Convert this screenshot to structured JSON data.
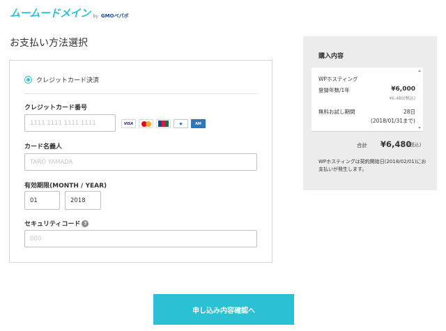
{
  "header": {
    "logo_text": "ムームードメイン",
    "logo_by": "by",
    "logo_company": "GMOペパボ"
  },
  "page": {
    "title": "お支払い方法選択"
  },
  "payment": {
    "method_label": "クレジットカード決済",
    "card_number": {
      "label": "クレジットカード番号",
      "placeholder": "1111 1111 1111 1111"
    },
    "card_brands": [
      "VISA",
      "MasterCard",
      "JCB",
      "Diners Club",
      "American Express"
    ],
    "card_holder": {
      "label": "カード名義人",
      "placeholder": "TARO YAMADA"
    },
    "expiry": {
      "label": "有効期限(MONTH / YEAR)",
      "month": "01",
      "year": "2018"
    },
    "security_code": {
      "label": "セキュリティコード",
      "placeholder": "000",
      "help_symbol": "?"
    }
  },
  "summary": {
    "title": "購入内容",
    "plan": "WPホスティング",
    "term_label": "登録年数/1年",
    "term_price": "¥6,000",
    "term_price_tax": "¥6,480(税込)",
    "trial_label": "無料お試し期間",
    "trial_days": "28日",
    "trial_until": "(2018/01/31まで)",
    "total_label": "合計",
    "total_amount": "¥6,480",
    "total_tax": "(税込)",
    "note": "WPホスティングは契約開始日(2018/02/01)にお支払いが発生します。"
  },
  "submit_label": "申し込み内容確認へ",
  "colors": {
    "accent": "#29c1d3",
    "summary_bg": "#ececec"
  }
}
